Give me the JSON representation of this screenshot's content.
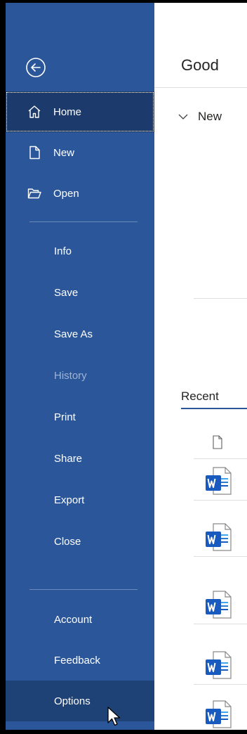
{
  "sidebar": {
    "back_icon": "back-arrow-circle-icon",
    "items": [
      {
        "label": "Home",
        "icon": "home-icon",
        "state": "active"
      },
      {
        "label": "New",
        "icon": "new-document-icon",
        "state": "normal"
      },
      {
        "label": "Open",
        "icon": "open-folder-icon",
        "state": "normal"
      },
      {
        "label": "Info",
        "state": "normal"
      },
      {
        "label": "Save",
        "state": "normal"
      },
      {
        "label": "Save As",
        "state": "normal"
      },
      {
        "label": "History",
        "state": "disabled"
      },
      {
        "label": "Print",
        "state": "normal"
      },
      {
        "label": "Share",
        "state": "normal"
      },
      {
        "label": "Export",
        "state": "normal"
      },
      {
        "label": "Close",
        "state": "normal"
      },
      {
        "label": "Account",
        "state": "normal"
      },
      {
        "label": "Feedback",
        "state": "normal"
      },
      {
        "label": "Options",
        "state": "hover"
      }
    ]
  },
  "main": {
    "greeting": "Good",
    "new_section": {
      "label": "New",
      "expanded": true
    },
    "recent_tab": {
      "label": "Recent"
    },
    "file_column_icon": "document-outline-icon",
    "recent_files": [
      {
        "icon": "word-document-icon"
      },
      {
        "icon": "word-document-icon"
      },
      {
        "icon": "word-document-icon"
      },
      {
        "icon": "word-document-icon"
      },
      {
        "icon": "word-document-icon"
      }
    ]
  },
  "colors": {
    "sidebar_bg": "#2b579a",
    "active_bg": "#1c3a6b",
    "hover_bg": "#1e4276",
    "disabled_text": "#9fb4d6",
    "word_blue": "#185abd"
  }
}
